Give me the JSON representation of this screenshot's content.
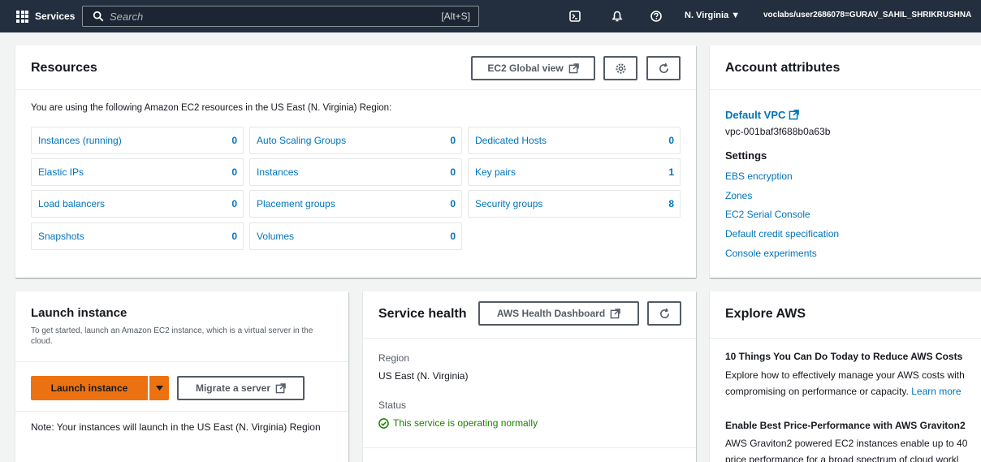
{
  "topnav": {
    "services_label": "Services",
    "search_placeholder": "Search",
    "search_shortcut": "[Alt+S]",
    "region": "N. Virginia ▼",
    "user": "voclabs/user2686078=GURAV_SAHIL_SHRIKRUSHNA"
  },
  "resources": {
    "title": "Resources",
    "global_view_label": "EC2 Global view",
    "intro": "You are using the following Amazon EC2 resources in the US East (N. Virginia) Region:",
    "items": [
      {
        "label": "Instances (running)",
        "count": "0"
      },
      {
        "label": "Auto Scaling Groups",
        "count": "0"
      },
      {
        "label": "Dedicated Hosts",
        "count": "0"
      },
      {
        "label": "Elastic IPs",
        "count": "0"
      },
      {
        "label": "Instances",
        "count": "0"
      },
      {
        "label": "Key pairs",
        "count": "1"
      },
      {
        "label": "Load balancers",
        "count": "0"
      },
      {
        "label": "Placement groups",
        "count": "0"
      },
      {
        "label": "Security groups",
        "count": "8"
      },
      {
        "label": "Snapshots",
        "count": "0"
      },
      {
        "label": "Volumes",
        "count": "0"
      }
    ]
  },
  "account": {
    "title": "Account attributes",
    "default_vpc_label": "Default VPC",
    "vpc_id": "vpc-001baf3f688b0a63b",
    "settings_heading": "Settings",
    "links": [
      "EBS encryption",
      "Zones",
      "EC2 Serial Console",
      "Default credit specification",
      "Console experiments"
    ]
  },
  "launch": {
    "title": "Launch instance",
    "description": "To get started, launch an Amazon EC2 instance, which is a virtual server in the cloud.",
    "launch_label": "Launch instance",
    "migrate_label": "Migrate a server",
    "note": "Note: Your instances will launch in the US East (N. Virginia) Region"
  },
  "health": {
    "title": "Service health",
    "dashboard_label": "AWS Health Dashboard",
    "region_label": "Region",
    "region_value": "US East (N. Virginia)",
    "status_label": "Status",
    "status_value": "This service is operating normally"
  },
  "explore": {
    "title": "Explore AWS",
    "item1_title": "10 Things You Can Do Today to Reduce AWS Costs",
    "item1_line1": "Explore how to effectively manage your AWS costs with",
    "item1_line2": "compromising on performance or capacity.",
    "item1_link": "Learn more",
    "item2_title": "Enable Best Price-Performance with AWS Graviton2",
    "item2_line1": "AWS Graviton2 powered EC2 instances enable up to 40",
    "item2_line2": "price performance for a broad spectrum of cloud workl"
  },
  "colors": {
    "nav_bg": "#232f3e",
    "link": "#0073bb",
    "primary": "#ec7211",
    "success": "#1d8102"
  }
}
